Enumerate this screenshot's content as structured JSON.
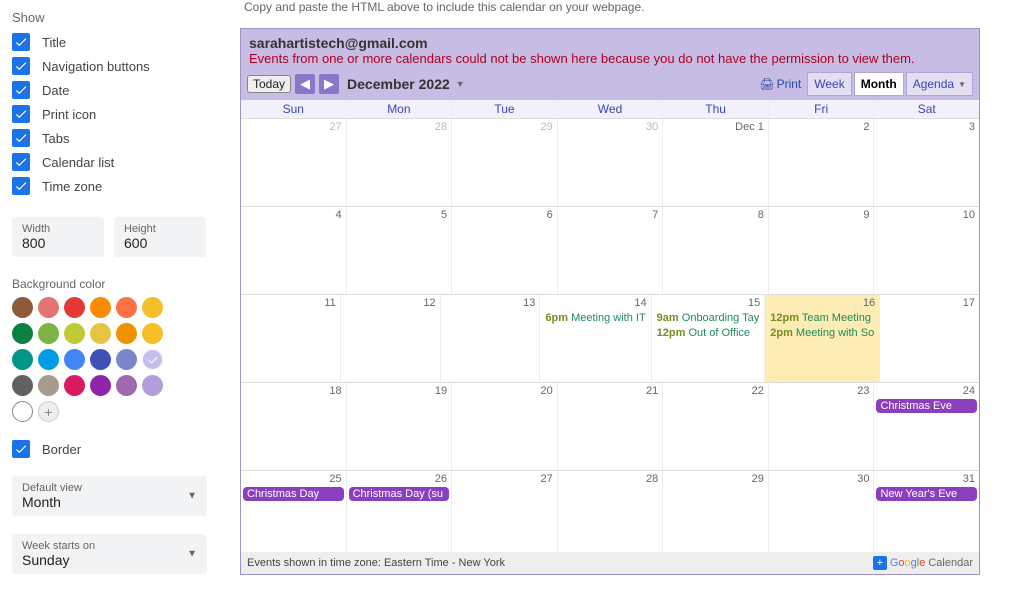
{
  "sidebar": {
    "heading": "Show",
    "checkboxes": [
      "Title",
      "Navigation buttons",
      "Date",
      "Print icon",
      "Tabs",
      "Calendar list",
      "Time zone"
    ],
    "width_label": "Width",
    "width_value": "800",
    "height_label": "Height",
    "height_value": "600",
    "bgcolor_label": "Background color",
    "swatch_rows": [
      [
        "#8e5a3b",
        "#e57373",
        "#e53935",
        "#fb8c00",
        "#ff7043",
        "#f6bf26"
      ],
      [
        "#0b8043",
        "#7cb342",
        "#c0ca33",
        "#e4c441",
        "#f09300",
        "#f6bf26"
      ],
      [
        "#009688",
        "#039be5",
        "#4285f4",
        "#3f51b5",
        "#7986cb",
        "#a99ce0"
      ],
      [
        "#616161",
        "#a79b8e",
        "#d81b60",
        "#8e24aa",
        "#9e69af",
        "#b39ddb"
      ]
    ],
    "selected_swatch": "#a99ce0",
    "border_label": "Border",
    "default_view_label": "Default view",
    "default_view_value": "Month",
    "week_starts_label": "Week starts on",
    "week_starts_value": "Sunday"
  },
  "main": {
    "topnote": "Copy and paste the HTML above to include this calendar on your webpage.",
    "owner": "sarahartistech@gmail.com",
    "error": "Events from one or more calendars could not be shown here because you do not have the permission to view them.",
    "today_btn": "Today",
    "month_title": "December 2022",
    "print_label": "Print",
    "tabs": {
      "week": "Week",
      "month": "Month",
      "agenda": "Agenda"
    },
    "day_headers": [
      "Sun",
      "Mon",
      "Tue",
      "Wed",
      "Thu",
      "Fri",
      "Sat"
    ],
    "weeks": [
      [
        {
          "n": "27",
          "o": true
        },
        {
          "n": "28",
          "o": true
        },
        {
          "n": "29",
          "o": true
        },
        {
          "n": "30",
          "o": true
        },
        {
          "n": "Dec 1"
        },
        {
          "n": "2"
        },
        {
          "n": "3"
        }
      ],
      [
        {
          "n": "4"
        },
        {
          "n": "5"
        },
        {
          "n": "6"
        },
        {
          "n": "7"
        },
        {
          "n": "8"
        },
        {
          "n": "9"
        },
        {
          "n": "10"
        }
      ],
      [
        {
          "n": "11"
        },
        {
          "n": "12"
        },
        {
          "n": "13"
        },
        {
          "n": "14",
          "ev": [
            {
              "t": "6pm",
              "l": "Meeting with IT"
            }
          ]
        },
        {
          "n": "15",
          "ev": [
            {
              "t": "9am",
              "l": "Onboarding Tay"
            },
            {
              "t": "12pm",
              "l": "Out of Office"
            }
          ]
        },
        {
          "n": "16",
          "hl": true,
          "ev": [
            {
              "t": "12pm",
              "l": "Team Meeting"
            },
            {
              "t": "2pm",
              "l": "Meeting with So"
            }
          ]
        },
        {
          "n": "17"
        }
      ],
      [
        {
          "n": "18"
        },
        {
          "n": "19"
        },
        {
          "n": "20"
        },
        {
          "n": "21"
        },
        {
          "n": "22"
        },
        {
          "n": "23"
        },
        {
          "n": "24",
          "ad": "Christmas Eve"
        }
      ],
      [
        {
          "n": "25",
          "ad": "Christmas Day"
        },
        {
          "n": "26",
          "ad": "Christmas Day (su"
        },
        {
          "n": "27"
        },
        {
          "n": "28"
        },
        {
          "n": "29"
        },
        {
          "n": "30"
        },
        {
          "n": "31",
          "ad": "New Year's Eve"
        }
      ]
    ],
    "footer_tz": "Events shown in time zone: Eastern Time - New York",
    "footer_brand": "Calendar"
  }
}
